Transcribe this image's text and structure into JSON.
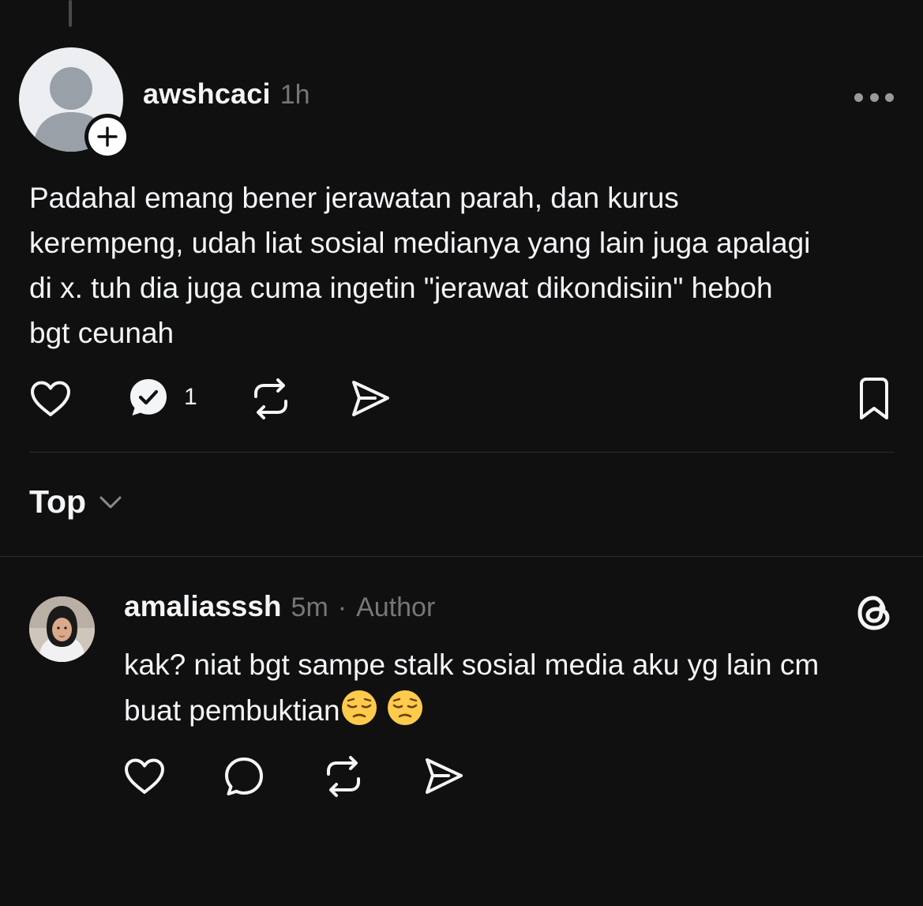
{
  "post": {
    "username": "awshcaci",
    "time": "1h",
    "text": "Padahal emang bener jerawatan parah, dan kurus\nkerempeng, udah liat sosial medianya yang lain juga apalagi\ndi x. tuh dia juga cuma ingetin \"jerawat dikondisiin\" heboh\nbgt ceunah",
    "reply_count": "1",
    "icons": [
      "heart-icon",
      "reply-checked-icon",
      "repost-icon",
      "share-icon",
      "bookmark-icon",
      "more-icon",
      "follow-plus-icon"
    ]
  },
  "sort": {
    "label": "Top"
  },
  "reply": {
    "username": "amaliasssh",
    "time": "5m",
    "separator": "·",
    "badge": "Author",
    "text_line1": "kak? niat bgt sampe stalk sosial media aku yg lain cm",
    "text_line2": "buat pembuktian",
    "emojis": [
      "pensive-face",
      "pensive-face"
    ],
    "icons": [
      "heart-icon",
      "comment-icon",
      "repost-icon",
      "share-icon",
      "threads-logo-icon"
    ]
  },
  "colors": {
    "background": "#101010",
    "text": "#f3f5f7",
    "muted": "#777777",
    "divider": "#2e2e2e"
  }
}
